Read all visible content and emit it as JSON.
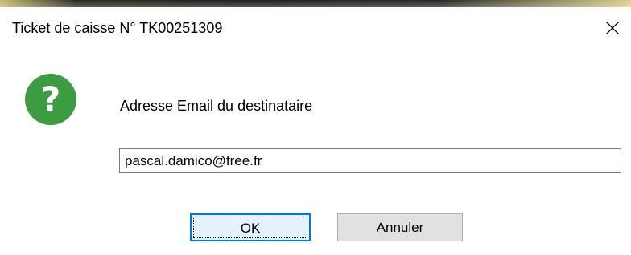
{
  "window": {
    "title": "Ticket de caisse N° TK00251309",
    "close_icon": "close-icon"
  },
  "dialog": {
    "icon": "question-icon",
    "icon_glyph": "?",
    "icon_color": "#3d9b41",
    "prompt": "Adresse Email du destinataire",
    "email_value": "pascal.damico@free.fr"
  },
  "buttons": {
    "ok_label": "OK",
    "cancel_label": "Annuler"
  },
  "colors": {
    "accent": "#0078d7",
    "ok_background": "#e5f1fb",
    "button_background": "#e1e1e1"
  }
}
